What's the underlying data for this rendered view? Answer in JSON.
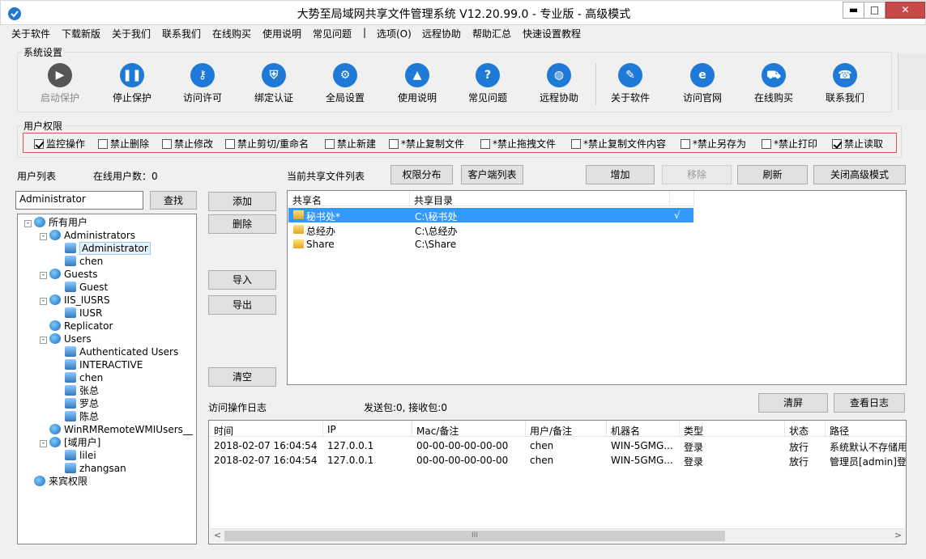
{
  "window": {
    "title": "大势至局域网共享文件管理系统 V12.20.99.0 - 专业版 - 高级模式",
    "min": "▬",
    "max": "□",
    "close": "✕"
  },
  "menu": [
    "关于软件",
    "下载新版",
    "关于我们",
    "联系我们",
    "在线购买",
    "使用说明",
    "常见问题",
    "|",
    "选项(O)",
    "远程协助",
    "帮助汇总",
    "快速设置教程"
  ],
  "toolbar": {
    "legend": "系统设置",
    "items": [
      {
        "label": "启动保护",
        "icon": "play-icon",
        "color": "#555555"
      },
      {
        "label": "停止保护",
        "icon": "pause-icon",
        "color": "#1e7ad6"
      },
      {
        "label": "访问许可",
        "icon": "key-icon",
        "color": "#1e7ad6"
      },
      {
        "label": "绑定认证",
        "icon": "shield-icon",
        "color": "#1e7ad6"
      },
      {
        "label": "全局设置",
        "icon": "gear-icon",
        "color": "#1e7ad6"
      },
      {
        "label": "使用说明",
        "icon": "graduation-cap-icon",
        "color": "#1e7ad6"
      },
      {
        "label": "常见问题",
        "icon": "question-icon",
        "color": "#1e7ad6"
      },
      {
        "label": "远程协助",
        "icon": "globe-icon",
        "color": "#1e7ad6"
      },
      {
        "label": "关于软件",
        "icon": "document-icon",
        "color": "#1e7ad6"
      },
      {
        "label": "访问官网",
        "icon": "ie-icon",
        "color": "#1e7ad6"
      },
      {
        "label": "在线购买",
        "icon": "cart-icon",
        "color": "#1e7ad6"
      },
      {
        "label": "联系我们",
        "icon": "phone-icon",
        "color": "#1e7ad6"
      }
    ]
  },
  "permissions": {
    "legend": "用户权限",
    "items": [
      {
        "label": "监控操作",
        "checked": true
      },
      {
        "label": "禁止删除",
        "checked": false
      },
      {
        "label": "禁止修改",
        "checked": false
      },
      {
        "label": "禁止剪切/重命名",
        "checked": false
      },
      {
        "label": "禁止新建",
        "checked": false
      },
      {
        "label": "*禁止复制文件",
        "checked": false
      },
      {
        "label": "*禁止拖拽文件",
        "checked": false
      },
      {
        "label": "*禁止复制文件内容",
        "checked": false
      },
      {
        "label": "*禁止另存为",
        "checked": false
      },
      {
        "label": "*禁止打印",
        "checked": false
      },
      {
        "label": "禁止读取",
        "checked": true
      }
    ]
  },
  "users": {
    "title": "用户列表",
    "online": "在线用户数：0",
    "search_value": "Administrator",
    "find": "查找",
    "tree": [
      {
        "label": "所有用户",
        "level": 0,
        "icon": "globe",
        "exp": "-"
      },
      {
        "label": "Administrators",
        "level": 1,
        "icon": "globe",
        "exp": "-"
      },
      {
        "label": "Administrator",
        "level": 2,
        "icon": "monitor",
        "selected": true
      },
      {
        "label": "chen",
        "level": 2,
        "icon": "monitor"
      },
      {
        "label": "Guests",
        "level": 1,
        "icon": "globe",
        "exp": "-"
      },
      {
        "label": "Guest",
        "level": 2,
        "icon": "monitor"
      },
      {
        "label": "IIS_IUSRS",
        "level": 1,
        "icon": "globe",
        "exp": "-"
      },
      {
        "label": "IUSR",
        "level": 2,
        "icon": "monitor"
      },
      {
        "label": "Replicator",
        "level": 1,
        "icon": "globe"
      },
      {
        "label": "Users",
        "level": 1,
        "icon": "globe",
        "exp": "-"
      },
      {
        "label": "Authenticated Users",
        "level": 2,
        "icon": "monitor"
      },
      {
        "label": "INTERACTIVE",
        "level": 2,
        "icon": "monitor"
      },
      {
        "label": "chen",
        "level": 2,
        "icon": "monitor"
      },
      {
        "label": "张总",
        "level": 2,
        "icon": "monitor"
      },
      {
        "label": "罗总",
        "level": 2,
        "icon": "monitor"
      },
      {
        "label": "陈总",
        "level": 2,
        "icon": "monitor"
      },
      {
        "label": "WinRMRemoteWMIUsers__",
        "level": 1,
        "icon": "globe"
      },
      {
        "label": "[域用户]",
        "level": 1,
        "icon": "globe",
        "exp": "-"
      },
      {
        "label": "lilei",
        "level": 2,
        "icon": "monitor"
      },
      {
        "label": "zhangsan",
        "level": 2,
        "icon": "monitor"
      },
      {
        "label": "来宾权限",
        "level": 0,
        "icon": "globe"
      }
    ]
  },
  "mid_buttons": {
    "add": "添加",
    "delete": "删除",
    "import": "导入",
    "export": "导出",
    "clear": "清空"
  },
  "shares": {
    "title": "当前共享文件列表",
    "perm_dist": "权限分布",
    "client_list": "客户端列表",
    "add": "增加",
    "remove": "移除",
    "refresh": "刷新",
    "close_adv": "关闭高级模式",
    "columns": [
      "共享名",
      "共享目录",
      ""
    ],
    "rows": [
      {
        "name": "秘书处*",
        "path": "C:\\秘书处",
        "mark": "√",
        "selected": true
      },
      {
        "name": "总经办",
        "path": "C:\\总经办",
        "mark": ""
      },
      {
        "name": "Share",
        "path": "C:\\Share",
        "mark": ""
      }
    ]
  },
  "log": {
    "title": "访问操作日志",
    "stats": "发送包:0, 接收包:0",
    "clear_screen": "清屏",
    "view_log": "查看日志",
    "columns": [
      "时间",
      "IP",
      "Mac/备注",
      "用户/备注",
      "机器名",
      "类型",
      "状态",
      "路径"
    ],
    "rows": [
      [
        "2018-02-07 16:04:54",
        "127.0.0.1",
        "00-00-00-00-00-00",
        "chen",
        "WIN-5GMG...",
        "登录",
        "放行",
        "系统默认不存储用"
      ],
      [
        "2018-02-07 16:04:54",
        "127.0.0.1",
        "00-00-00-00-00-00",
        "chen",
        "WIN-5GMG...",
        "登录",
        "放行",
        "管理员[admin]登"
      ]
    ],
    "scroll_left": "<",
    "scroll_right": ">",
    "scroll_grip": "III"
  },
  "colors": {
    "accent": "#1e7ad6",
    "selection": "#3399ff",
    "perm_border": "#e05050",
    "close_red": "#c74a4a"
  }
}
